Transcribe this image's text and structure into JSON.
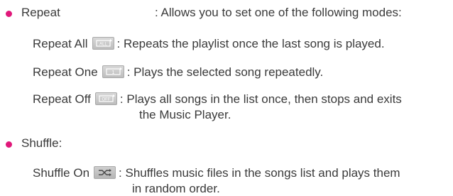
{
  "colors": {
    "bullet": "#e0187a",
    "text": "#3a3a3a",
    "icon_bg": "#cfcfcf"
  },
  "repeat": {
    "term": "Repeat",
    "desc": ": Allows you to set one of the following modes:",
    "modes": [
      {
        "label": "Repeat All",
        "icon": "repeat-all-icon",
        "icon_text": "ALL",
        "desc": ": Repeats the playlist once the last song is played."
      },
      {
        "label": "Repeat One",
        "icon": "repeat-one-icon",
        "icon_text": "1",
        "desc": ": Plays the selected song repeatedly."
      },
      {
        "label": "Repeat Off",
        "icon": "repeat-off-icon",
        "icon_text": "OFF",
        "desc": ": Plays all songs in the list once, then stops and exits",
        "desc_cont": "the Music Player."
      }
    ]
  },
  "shuffle": {
    "term": "Shuffle:",
    "modes": [
      {
        "label": "Shuffle On",
        "icon": "shuffle-on-icon",
        "desc": ": Shuffles music files in the songs list and plays them",
        "desc_cont": "in random order."
      }
    ]
  }
}
